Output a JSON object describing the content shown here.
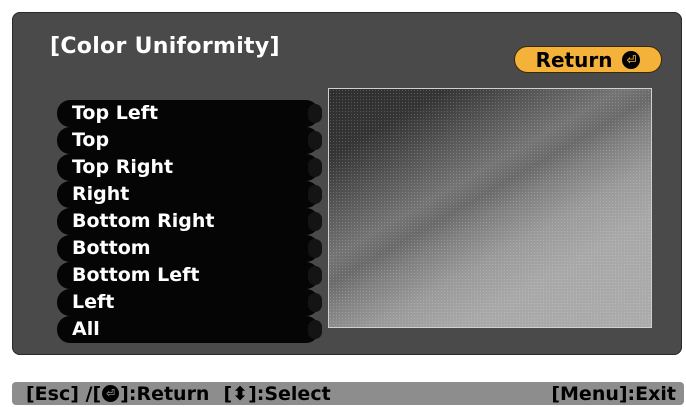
{
  "dialog": {
    "title": "[Color Uniformity]",
    "return_label": "Return",
    "return_icon": "enter-icon"
  },
  "menu": {
    "items": [
      {
        "label": "Top Left"
      },
      {
        "label": "Top"
      },
      {
        "label": "Top Right"
      },
      {
        "label": "Right"
      },
      {
        "label": "Bottom Right"
      },
      {
        "label": "Bottom"
      },
      {
        "label": "Bottom Left"
      },
      {
        "label": "Left"
      },
      {
        "label": "All"
      }
    ]
  },
  "footer": {
    "esc_label": "[Esc] /[",
    "return_text": "]:Return",
    "select_text": "[⬍]:Select",
    "exit_text": "[Menu]:Exit"
  },
  "colors": {
    "panel": "#4a4a4a",
    "accent": "#f4b23a",
    "footer": "#8d8d8d"
  }
}
